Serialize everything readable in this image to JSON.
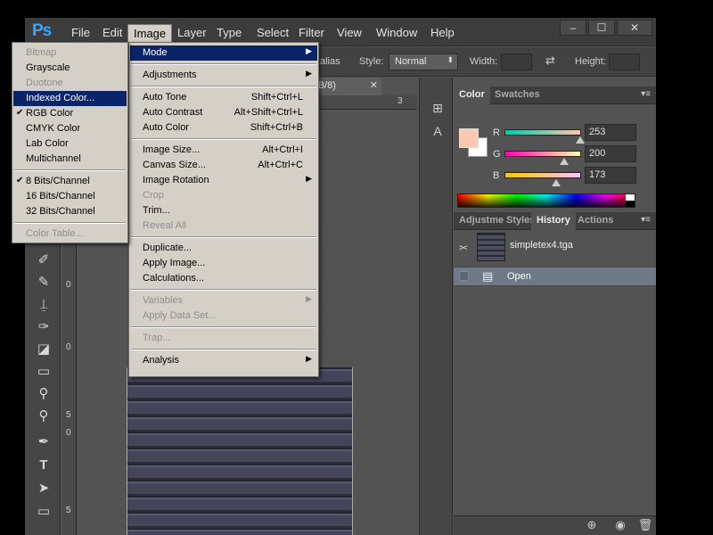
{
  "app": {
    "logo": "Ps"
  },
  "menubar": {
    "items": [
      "File",
      "Edit",
      "Image",
      "Layer",
      "Type",
      "Select",
      "Filter",
      "View",
      "Window",
      "Help"
    ],
    "window_buttons": [
      "–",
      "☐",
      "✕"
    ]
  },
  "options_bar": {
    "alias_fragment": "alias",
    "style_label": "Style:",
    "style_value": "Normal",
    "width_label": "Width:",
    "height_label": "Height:"
  },
  "document": {
    "tab_label": "s (RGB/8)",
    "close": "✕"
  },
  "rulers": {
    "h_numbers": [
      "3"
    ],
    "v_numbers": [
      "0",
      "0",
      "5",
      "0",
      "5"
    ]
  },
  "image_menu": {
    "items": [
      {
        "label": "Mode",
        "shortcut": "",
        "submenu": true,
        "disabled": false,
        "selected": true
      },
      {
        "sep": true
      },
      {
        "label": "Adjustments",
        "shortcut": "",
        "submenu": true,
        "disabled": false
      },
      {
        "sep": true
      },
      {
        "label": "Auto Tone",
        "shortcut": "Shift+Ctrl+L"
      },
      {
        "label": "Auto Contrast",
        "shortcut": "Alt+Shift+Ctrl+L"
      },
      {
        "label": "Auto Color",
        "shortcut": "Shift+Ctrl+B"
      },
      {
        "sep": true
      },
      {
        "label": "Image Size...",
        "shortcut": "Alt+Ctrl+I"
      },
      {
        "label": "Canvas Size...",
        "shortcut": "Alt+Ctrl+C"
      },
      {
        "label": "Image Rotation",
        "shortcut": "",
        "submenu": true
      },
      {
        "label": "Crop",
        "disabled": true
      },
      {
        "label": "Trim..."
      },
      {
        "label": "Reveal All",
        "disabled": true
      },
      {
        "sep": true
      },
      {
        "label": "Duplicate..."
      },
      {
        "label": "Apply Image..."
      },
      {
        "label": "Calculations..."
      },
      {
        "sep": true
      },
      {
        "label": "Variables",
        "submenu": true,
        "disabled": true
      },
      {
        "label": "Apply Data Set...",
        "disabled": true
      },
      {
        "sep": true
      },
      {
        "label": "Trap...",
        "disabled": true
      },
      {
        "sep": true
      },
      {
        "label": "Analysis",
        "submenu": true
      }
    ]
  },
  "mode_menu": {
    "items": [
      {
        "label": "Bitmap",
        "disabled": true
      },
      {
        "label": "Grayscale"
      },
      {
        "label": "Duotone",
        "disabled": true
      },
      {
        "label": "Indexed Color...",
        "selected": true
      },
      {
        "label": "RGB Color",
        "checked": true
      },
      {
        "label": "CMYK Color"
      },
      {
        "label": "Lab Color"
      },
      {
        "label": "Multichannel"
      },
      {
        "sep": true
      },
      {
        "label": "8 Bits/Channel",
        "checked": true
      },
      {
        "label": "16 Bits/Channel"
      },
      {
        "label": "32 Bits/Channel"
      },
      {
        "sep": true
      },
      {
        "label": "Color Table...",
        "disabled": true
      }
    ],
    "check_glyph": "✔",
    "arrow_glyph": "▶"
  },
  "color_panel": {
    "tabs": [
      "Color",
      "Swatches"
    ],
    "foreground": "#fdc8ad",
    "background": "#ffffff",
    "channels": [
      {
        "label": "R",
        "value": "253",
        "fraction": 0.992
      },
      {
        "label": "G",
        "value": "200",
        "fraction": 0.784
      },
      {
        "label": "B",
        "value": "173",
        "fraction": 0.678
      }
    ]
  },
  "history_panel": {
    "tabs": [
      "Adjustme",
      "Styles",
      "History",
      "Actions"
    ],
    "snapshot_name": "simpletex4.tga",
    "states": [
      "Open"
    ]
  },
  "tools": [
    "✐",
    "⦾",
    "✎",
    "⍊",
    "✑",
    "◪",
    "▭",
    "⚲",
    "⚲",
    "✒",
    "T",
    "➤",
    "▭"
  ],
  "dock_icons": [
    "⊞",
    "A"
  ],
  "footer_icons": [
    "⊕",
    "◉",
    "🗑"
  ]
}
